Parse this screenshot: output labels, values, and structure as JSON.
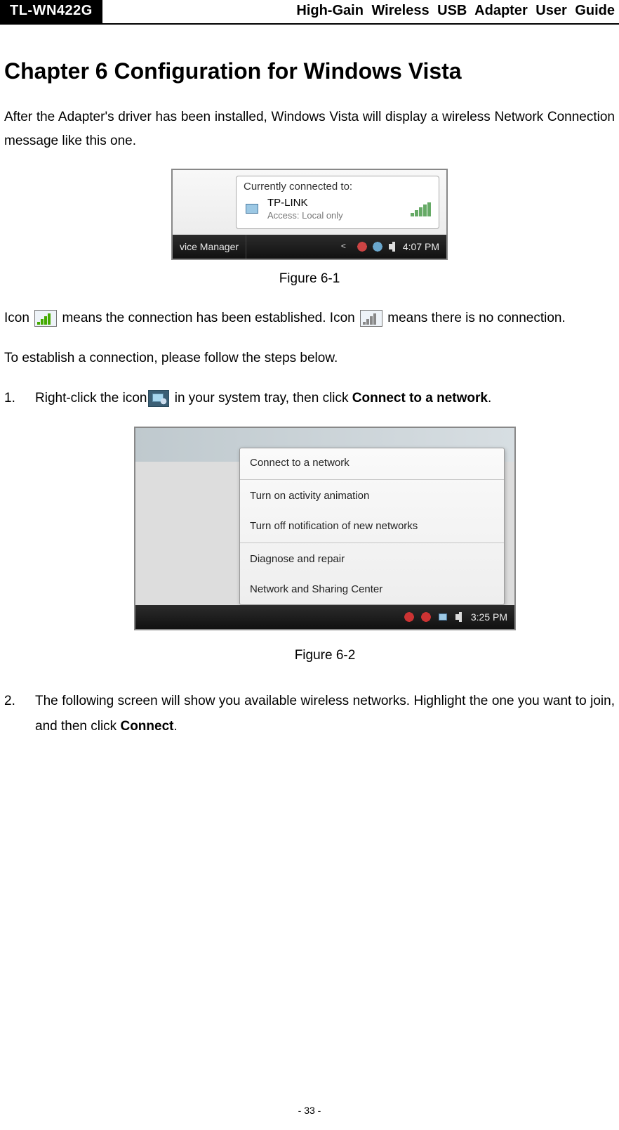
{
  "header": {
    "model": "TL-WN422G",
    "doc_title": "High-Gain Wireless USB Adapter User Guide"
  },
  "chapter": {
    "title": "Chapter 6 Configuration for Windows Vista"
  },
  "paragraphs": {
    "intro": "After the Adapter's driver has been installed, Windows Vista will display a wireless Network Connection message like this one.",
    "icon_pre": "Icon ",
    "icon_mid": " means the connection has been established. Icon ",
    "icon_post": " means there is no connection.",
    "establish": "To establish a connection, please follow the steps below."
  },
  "figures": {
    "f61": {
      "caption": "Figure 6-1",
      "balloon_title": "Currently connected to:",
      "network_name": "TP-LINK",
      "access_line": "Access:  Local only",
      "task_tab": "vice Manager",
      "taskbar_time": "4:07 PM"
    },
    "f62": {
      "caption": "Figure 6-2",
      "menu_items": [
        "Connect to a network",
        "Turn on activity animation",
        "Turn off notification of new networks",
        "Diagnose and repair",
        "Network and Sharing Center"
      ],
      "taskbar_time": "3:25 PM"
    }
  },
  "steps": {
    "s1_pre": "Right-click the icon",
    "s1_post": " in your system tray, then click ",
    "s1_bold": "Connect to a network",
    "s1_end": ".",
    "s2_pre": "The following screen will show you available wireless networks. Highlight the one you want to join, and then click ",
    "s2_bold": "Connect",
    "s2_end": "."
  },
  "page_number": "- 33 -"
}
